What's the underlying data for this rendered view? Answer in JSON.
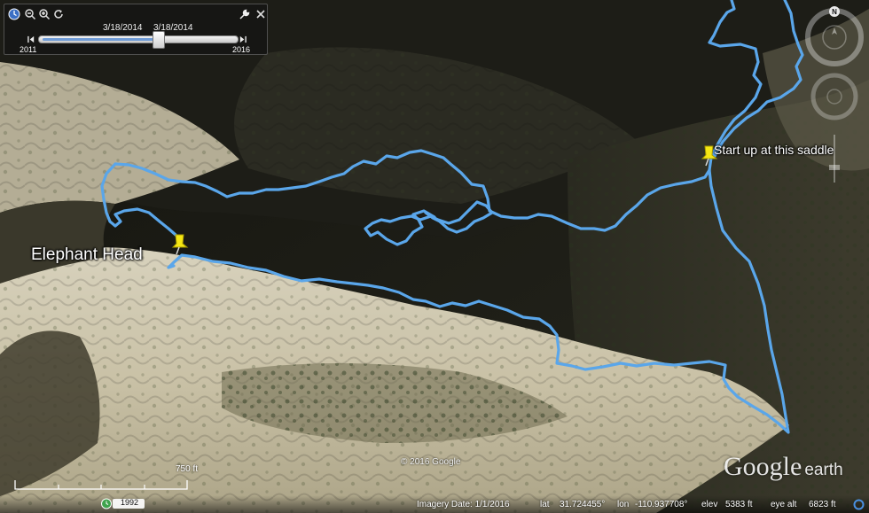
{
  "time_slider": {
    "start_date": "3/18/2014",
    "end_date": "3/18/2014",
    "start_year": "2011",
    "end_year": "2016",
    "thumb_fraction": 0.6
  },
  "placemarks": [
    {
      "label": "Elephant Head"
    },
    {
      "label": "Start up at this saddle"
    }
  ],
  "navigation": {
    "north_label": "N"
  },
  "scale": {
    "label": "750 ft"
  },
  "copyright": "© 2016 Google",
  "logo": {
    "google": "Google",
    "earth": "earth"
  },
  "status_bar": {
    "historical_year": "1992",
    "imagery_date": "Imagery Date: 1/1/2016",
    "lat_label": "lat",
    "lat_value": "31.724455°",
    "lon_label": "lon",
    "lon_value": "-110.937708°",
    "elev_label": "elev",
    "elev_value": "5383 ft",
    "eye_alt_label": "eye alt",
    "eye_alt_value": "6823 ft"
  },
  "colors": {
    "track": "#5aa6ea",
    "pin": "#f5e613",
    "slider_range": "#6f9bd6"
  }
}
